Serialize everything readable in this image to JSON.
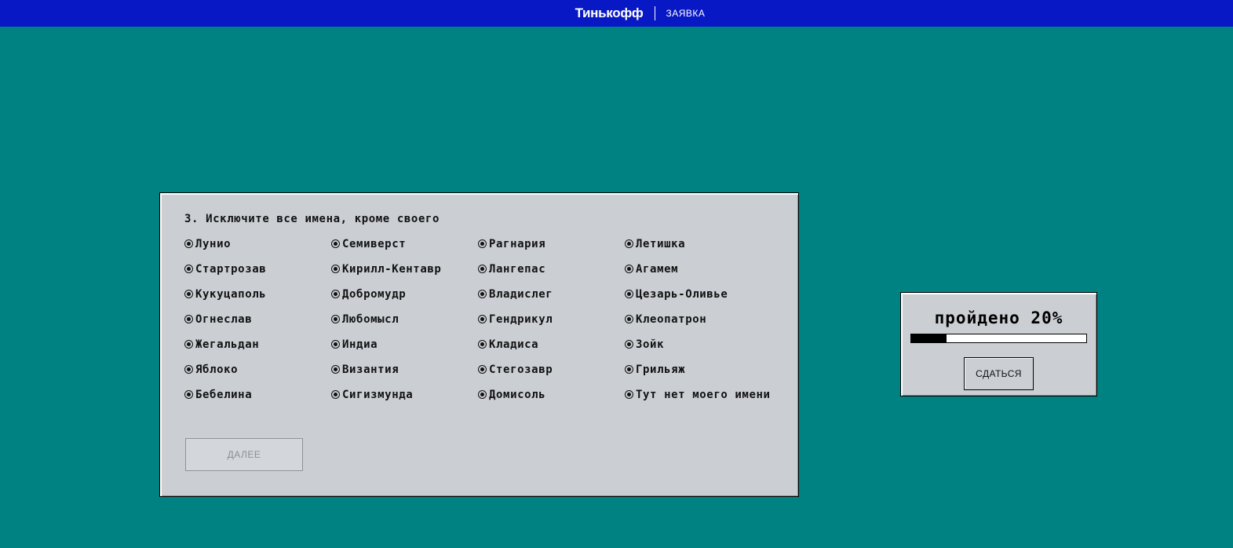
{
  "header": {
    "brand": "Тинькофф",
    "subtitle": "ЗАЯВКА",
    "bg_color": "#0718c4"
  },
  "background_color": "#008282",
  "quiz": {
    "question": "3. Исключите все имена, кроме своего",
    "columns": [
      [
        "Лунио",
        "Стартрозав",
        "Кукуцаполь",
        "Огнеслав",
        "Жегальдан",
        "Яблоко",
        "Бебелина"
      ],
      [
        "Семиверст",
        "Кирилл-Кентавр",
        "Добромудр",
        "Любомысл",
        "Индиа",
        "Византия",
        "Сигизмунда"
      ],
      [
        "Рагнария",
        "Лангепас",
        "Владислег",
        "Гендрикул",
        "Кладиса",
        "Стегозавр",
        "Домисоль"
      ],
      [
        "Летишка",
        "Агамем",
        "Цезарь-Оливье",
        "Клеопатрон",
        "Зойк",
        "Грильяж",
        "Тут нет моего имени"
      ]
    ],
    "next_label": "ДАЛЕЕ",
    "next_disabled": true
  },
  "progress": {
    "label": "пройдено 20%",
    "value": 0.2,
    "give_up_label": "СДАТЬСЯ"
  }
}
